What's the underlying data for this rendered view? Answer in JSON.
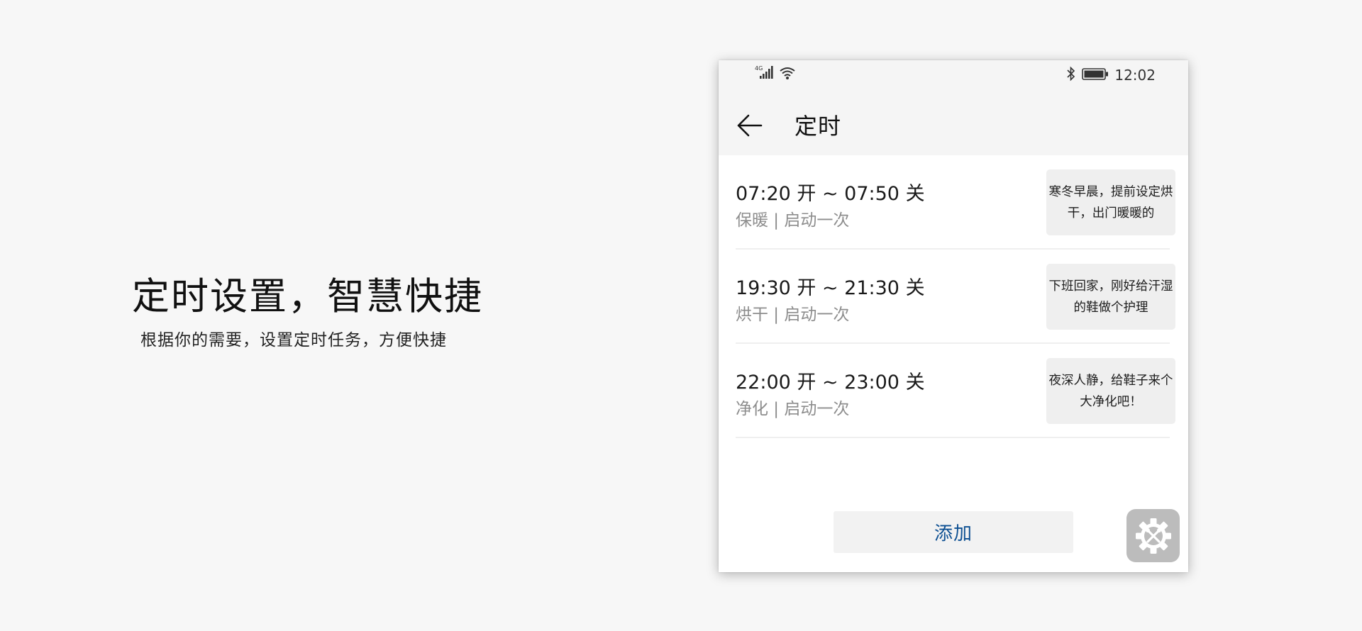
{
  "promo": {
    "title": "定时设置，智慧快捷",
    "subtitle": "根据你的需要，设置定时任务，方便快捷"
  },
  "status_bar": {
    "network_label": "4G",
    "time": "12:02",
    "icons": [
      "signal-icon",
      "wifi-icon",
      "bluetooth-icon",
      "battery-icon"
    ]
  },
  "header": {
    "title": "定时",
    "back_icon": "arrow-left-icon"
  },
  "schedules": [
    {
      "time_range": "07:20 开 ~ 07:50 关",
      "mode": "保暖 | 启动一次",
      "note": "寒冬早晨，提前设定烘干，出门暖暖的"
    },
    {
      "time_range": "19:30 开 ~ 21:30 关",
      "mode": "烘干 | 启动一次",
      "note": "下班回家，刚好给汗湿的鞋做个护理"
    },
    {
      "time_range": "22:00 开 ~ 23:00 关",
      "mode": "净化 | 启动一次",
      "note": "夜深人静，给鞋子来个大净化吧！"
    }
  ],
  "actions": {
    "add_label": "添加",
    "settings_icon": "gear-tools-icon"
  },
  "colors": {
    "page_background": "#f7f7f7",
    "accent_blue": "#0c4f92",
    "secondary_text": "#8d8d8d",
    "bubble_background": "#efefef",
    "fab_background": "#bcbcbc"
  }
}
